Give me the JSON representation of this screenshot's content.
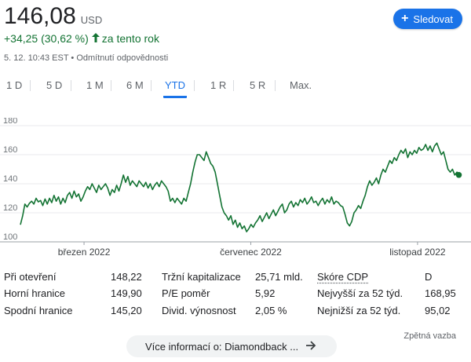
{
  "quote": {
    "price": "146,08",
    "currency": "USD",
    "change": "+34,25 (30,62 %)",
    "change_period": "za tento rok",
    "timestamp": "5. 12. 10:43 EST",
    "disclaimer": "Odmítnutí odpovědnosti",
    "meta_separator": "•"
  },
  "follow_button": {
    "label": "Sledovat",
    "icon": "plus-icon"
  },
  "range_tabs": [
    {
      "label": "1 D",
      "active": false
    },
    {
      "label": "5 D",
      "active": false
    },
    {
      "label": "1 M",
      "active": false
    },
    {
      "label": "6 M",
      "active": false
    },
    {
      "label": "YTD",
      "active": true
    },
    {
      "label": "1 R",
      "active": false
    },
    {
      "label": "5 R",
      "active": false
    },
    {
      "label": "Max.",
      "active": false
    }
  ],
  "chart_data": {
    "type": "line",
    "title": "",
    "xlabel": "",
    "ylabel": "",
    "ylim": [
      100,
      180
    ],
    "yticks": [
      "180",
      "160",
      "140",
      "120",
      "100"
    ],
    "xtick_labels": [
      "březen 2022",
      "červenec 2022",
      "listopad 2022"
    ],
    "grid": true,
    "line_color": "#137333",
    "series": [
      {
        "values": [
          111.8,
          118,
          126,
          124,
          126.5,
          128,
          126,
          130,
          127.5,
          128.5,
          125,
          129.5,
          126,
          130,
          127,
          132,
          128,
          131,
          126,
          130,
          127,
          132,
          134,
          130,
          135,
          131,
          133,
          128,
          131,
          135,
          138,
          136,
          140,
          137,
          134,
          139,
          136,
          138,
          140,
          137,
          132,
          136,
          134,
          139,
          135,
          140,
          146,
          141,
          145,
          139,
          142,
          140,
          138,
          142,
          140,
          138,
          141,
          137,
          140,
          136,
          139,
          141,
          138,
          142,
          140,
          138,
          135,
          128,
          130,
          127,
          130,
          128,
          126,
          130,
          128,
          134,
          140,
          148,
          155,
          160,
          160,
          158,
          156,
          162,
          158,
          154,
          152,
          148,
          140,
          132,
          124,
          120,
          118,
          115,
          118,
          112,
          115,
          110,
          113,
          109,
          111,
          107,
          109,
          112,
          110,
          113,
          115,
          118,
          114,
          117,
          120,
          116,
          119,
          122,
          118,
          121,
          124,
          126,
          120,
          122,
          126,
          128,
          124,
          127,
          125,
          129,
          127,
          130,
          126,
          128,
          131,
          127,
          128,
          125,
          128,
          130,
          126,
          129,
          127,
          131,
          126,
          128,
          127,
          125,
          124,
          119,
          113,
          111,
          114,
          120,
          122,
          125,
          123,
          128,
          132,
          138,
          142,
          139,
          141,
          144,
          140,
          146,
          150,
          148,
          152,
          156,
          154,
          158,
          156,
          160,
          163,
          161,
          164,
          158,
          162,
          160,
          163,
          161,
          165,
          163,
          164,
          167,
          163,
          166,
          162,
          166,
          168,
          164,
          160,
          162,
          156,
          150,
          148,
          150,
          146,
          148,
          146.08
        ]
      }
    ],
    "last_value": 146.08
  },
  "stats": {
    "col1": [
      {
        "label": "Při otevření",
        "value": "148,22"
      },
      {
        "label": "Horní hranice",
        "value": "149,90"
      },
      {
        "label": "Spodní hranice",
        "value": "145,20"
      }
    ],
    "col2": [
      {
        "label": "Tržní kapitalizace",
        "value": "25,71 mld."
      },
      {
        "label": "P/E poměr",
        "value": "5,92"
      },
      {
        "label": "Divid. výnosnost",
        "value": "2,05 %"
      }
    ],
    "col3": [
      {
        "label": "Skóre CDP",
        "value": "D"
      },
      {
        "label": "Nejvyšší za 52 týd.",
        "value": "168,95"
      },
      {
        "label": "Nejnižší za 52 týd.",
        "value": "95,02"
      }
    ]
  },
  "feedback_label": "Zpětná vazba",
  "more_info_label": "Více informací o: Diamondback ..."
}
